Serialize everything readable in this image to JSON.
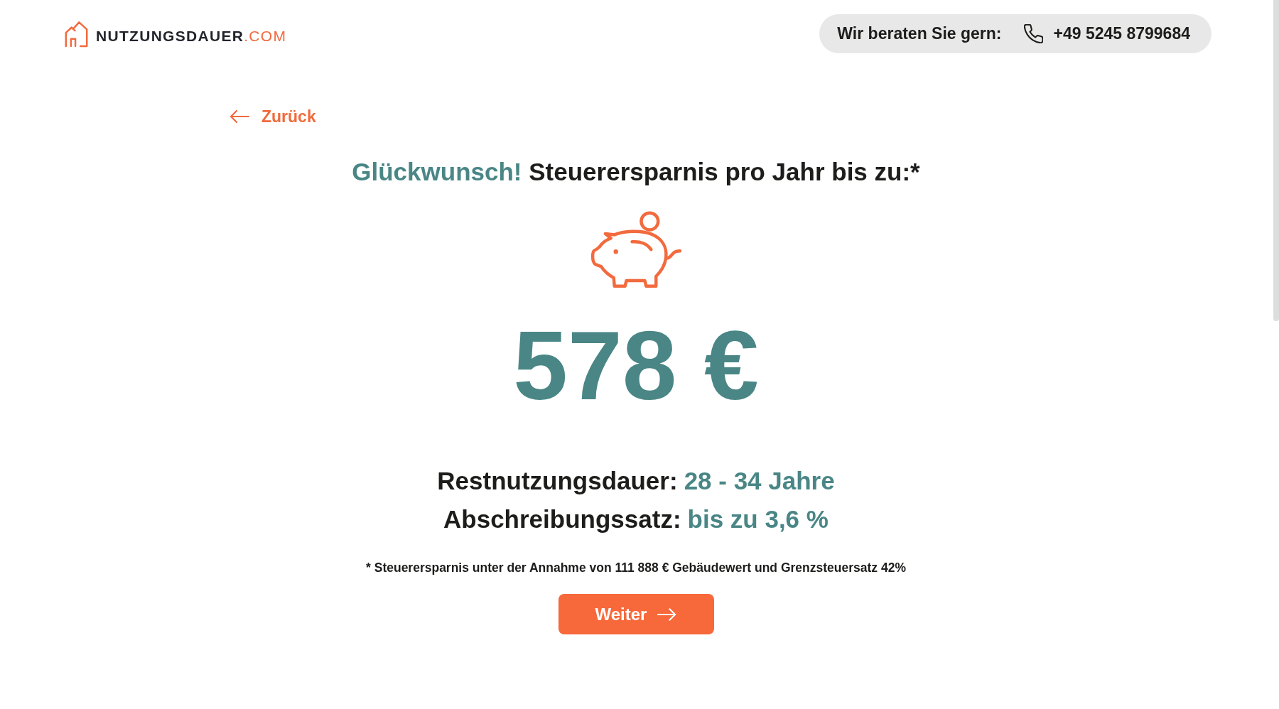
{
  "header": {
    "logo": {
      "name": "NUTZUNGSDAUER",
      "suffix": ".COM"
    },
    "contact": {
      "label": "Wir beraten Sie gern:",
      "phone": "+49 5245 8799684"
    }
  },
  "back_link": "Zurück",
  "result": {
    "heading_highlight": "Glückwunsch!",
    "heading": "Steuerersparnis pro Jahr bis zu:*",
    "amount": "578 €",
    "facts": [
      {
        "label": "Restnutzungsdauer:",
        "value": "28 - 34 Jahre"
      },
      {
        "label": "Abschreibungssatz:",
        "value": "bis zu 3,6 %"
      }
    ],
    "footnote": "* Steuerersparnis unter der Annahme von 111 888 € Gebäudewert und Grenzsteuersatz 42%"
  },
  "next_button": "Weiter"
}
